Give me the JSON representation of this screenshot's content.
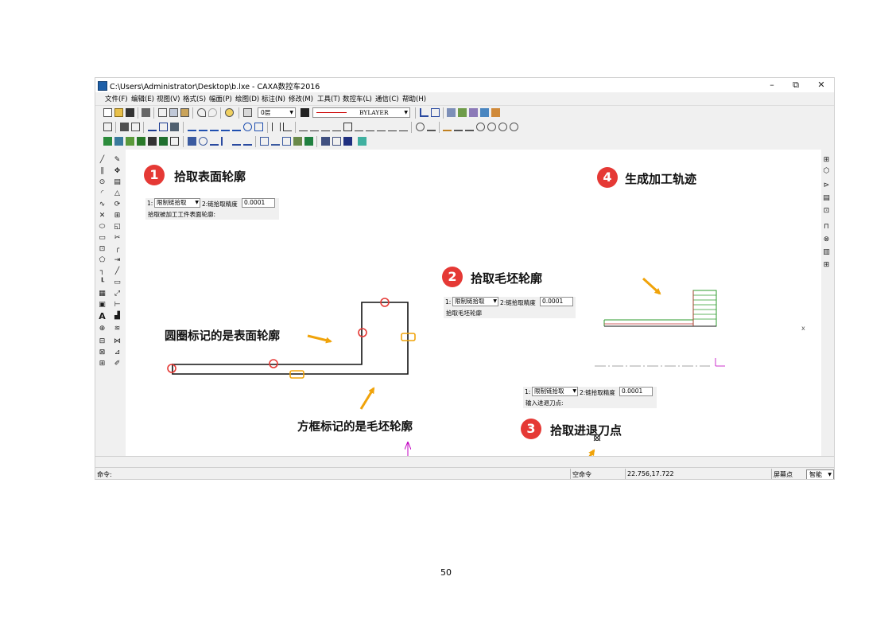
{
  "window": {
    "title": "C:\\Users\\Administrator\\Desktop\\b.lxe - CAXA数控车2016",
    "controls": {
      "minimize": "–",
      "maximize": "⧉",
      "close": "✕"
    }
  },
  "menu": [
    "文件(F)",
    "编辑(E)",
    "视图(V)",
    "格式(S)",
    "幅面(P)",
    "绘图(D)",
    "标注(N)",
    "修改(M)",
    "工具(T)",
    "数控车(L)",
    "通信(C)",
    "帮助(H)"
  ],
  "toolbar": {
    "layer_value": "0层",
    "linetype_value": "BYLAYER"
  },
  "steps": [
    {
      "number": "1",
      "label": "拾取表面轮廓"
    },
    {
      "number": "2",
      "label": "拾取毛坯轮廓"
    },
    {
      "number": "3",
      "label": "拾取进退刀点"
    },
    {
      "number": "4",
      "label": "生成加工轨迹"
    }
  ],
  "annotations": {
    "circle_note": "圆圈标记的是表面轮廓",
    "box_note": "方框标记的是毛坯轮廓"
  },
  "pick_bars": [
    {
      "index_label": "1:",
      "mode_value": "限制链拾取",
      "precision_label": "2:链拾取精度",
      "precision_value": "0.0001",
      "prompt": "拾取被加工工件表面轮廓:"
    },
    {
      "index_label": "1:",
      "mode_value": "限制链拾取",
      "precision_label": "2:链拾取精度",
      "precision_value": "0.0001",
      "prompt": "拾取毛坯轮廓"
    },
    {
      "index_label": "1:",
      "mode_value": "限制链拾取",
      "precision_label": "2:链拾取精度",
      "precision_value": "0.0001",
      "prompt": "输入进退刀点:"
    }
  ],
  "canvas_marker": "x",
  "status": {
    "command_label": "命令:",
    "empty_command": "空命令",
    "coordinates": "22.756,17.722",
    "snap_label": "屏幕点",
    "snap_mode": "智能"
  },
  "page_number": "50",
  "colors": {
    "badge": "#e53935",
    "arrow": "#f0a30a",
    "contour": "#111111",
    "axis": "#c000c0",
    "toolpath": "#2e9b2e"
  }
}
